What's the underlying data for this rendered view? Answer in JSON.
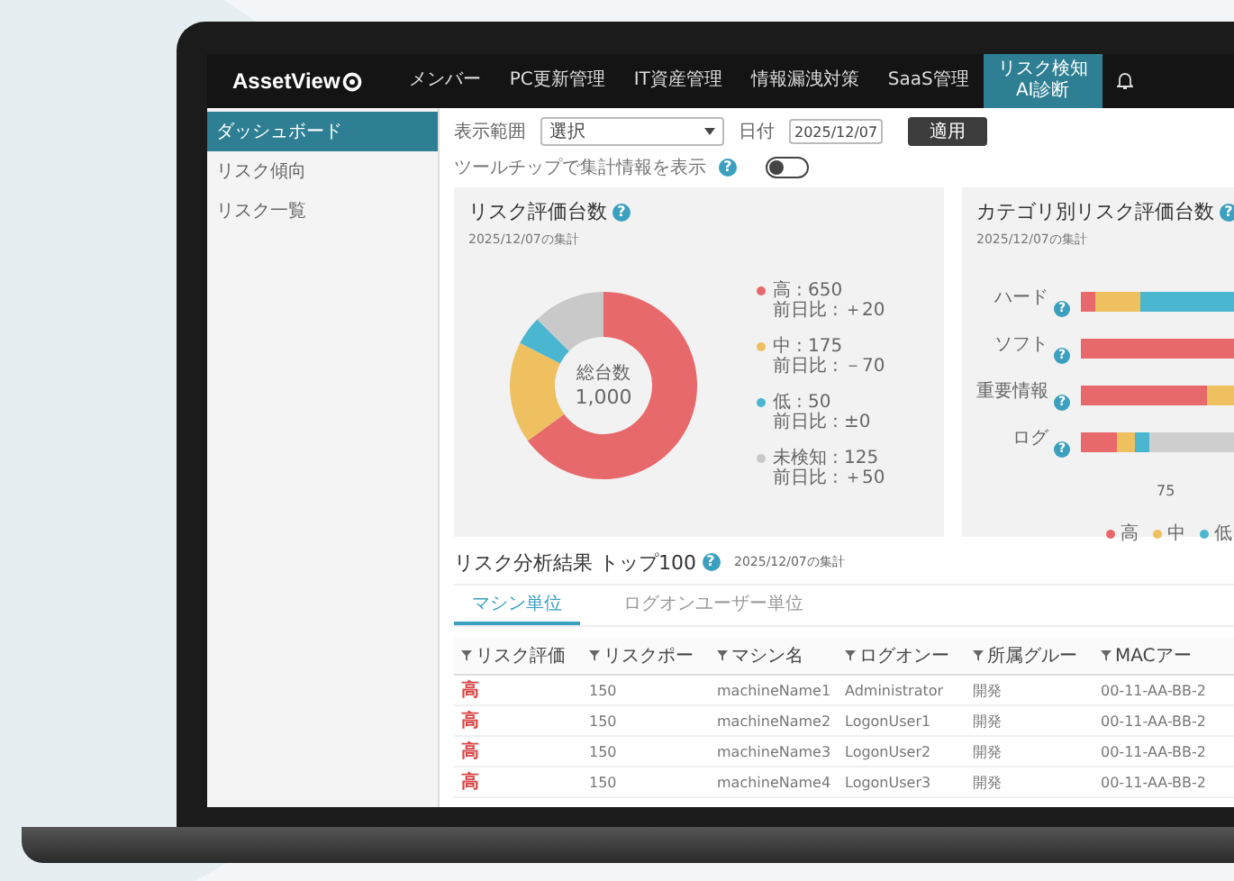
{
  "app": {
    "logo": "AssetView"
  },
  "nav": [
    {
      "label": "メンバー",
      "selected": false
    },
    {
      "label": "PC更新管理",
      "selected": false
    },
    {
      "label": "IT資産管理",
      "selected": false
    },
    {
      "label": "情報漏洩対策",
      "selected": false
    },
    {
      "label": "SaaS管理",
      "selected": false
    },
    {
      "label": "リスク検知",
      "badge": "AI診断",
      "selected": true
    }
  ],
  "sidebar": {
    "items": [
      {
        "label": "ダッシュボード",
        "selected": true
      },
      {
        "label": "リスク傾向",
        "selected": false
      },
      {
        "label": "リスク一覧",
        "selected": false
      }
    ]
  },
  "filters": {
    "range_label": "表示範囲",
    "range_value": "選択",
    "date_label": "日付",
    "date_value": "2025/12/07",
    "apply": "適用",
    "tooltip_toggle": {
      "label": "ツールチップで集計情報を表示",
      "help": "?",
      "on": false
    }
  },
  "donut_card": {
    "title": "リスク評価台数",
    "help": "?",
    "date": "2025/12/07の集計",
    "center_label": "総台数",
    "center_value": "1,000",
    "legend": [
      {
        "count": ": 650",
        "diff_label": "前日比",
        "diff": ": ＋20",
        "color": "#e8696b"
      },
      {
        "count": ": 175",
        "diff_label": "前日比",
        "diff": ": －70",
        "color": "#eec060"
      },
      {
        "count": ": 50",
        "diff_label": "前日比",
        "diff": ": ±0",
        "color": "#4ab6cf"
      },
      {
        "count": ": 125",
        "diff_label": "前日比",
        "diff": ": ＋50",
        "color": "#c9c9c9"
      }
    ],
    "chart_data": {
      "type": "donut",
      "categories": [
        "高",
        "中",
        "低",
        "未検知"
      ],
      "values": [
        65,
        17.5,
        5,
        12.5
      ]
    }
  },
  "bar_card": {
    "title": "カテゴリ別リスク評価台数",
    "help": "?",
    "date": "2025/12/07の集計",
    "categories": [
      {
        "label": "ハード",
        "help": "?"
      },
      {
        "label": "ソフト",
        "help": "?"
      },
      {
        "label": "重要情報",
        "help": "?"
      },
      {
        "label": "ログ",
        "help": "?"
      }
    ],
    "tick": "75",
    "legend": [
      {
        "name": "高",
        "color": "#e8696b"
      },
      {
        "name": "中",
        "color": "#eec060"
      },
      {
        "name": "低",
        "color": "#4ab6cf"
      }
    ]
  },
  "results": {
    "title": "リスク分析結果 トップ100",
    "help": "?",
    "date": "2025/12/07の集計",
    "tabs": [
      {
        "label": "マシン単位",
        "selected": true
      },
      {
        "label": "ログオンユーザー単位",
        "selected": false
      }
    ],
    "columns": [
      "リスク評価",
      "リスクポー",
      "マシン名",
      "ログオンー",
      "所属グルー",
      "MACアー"
    ],
    "rows": [
      [
        "高",
        "150",
        "machineName1",
        "Administrator",
        "開発",
        "00-11-AA-BB-2"
      ],
      [
        "高",
        "150",
        "machineName2",
        "LogonUser1",
        "開発",
        "00-11-AA-BB-2"
      ],
      [
        "高",
        "150",
        "machineName3",
        "LogonUser2",
        "開発",
        "00-11-AA-BB-2"
      ],
      [
        "高",
        "150",
        "machineName4",
        "LogonUser3",
        "開発",
        "00-11-AA-BB-2"
      ]
    ]
  }
}
